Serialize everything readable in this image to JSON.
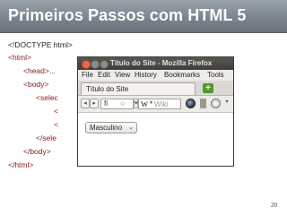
{
  "slide": {
    "title": "Primeiros Passos com HTML 5",
    "page_number": "20"
  },
  "code_lines": {
    "doctype": "<!DOCTYPE html>",
    "html_open": "<html>",
    "head": "<head>...",
    "body_open": "<body>",
    "select_open_partial": "<selec",
    "option1_partial": "<",
    "option2_partial": "<",
    "select_close_partial": "</sele",
    "body_close": "</body>",
    "html_close": "</html>"
  },
  "browser": {
    "window_title": "Título do Site - Mozilla Firefox",
    "menu": [
      "File",
      "Edit",
      "View",
      "History",
      "Bookmarks",
      "Tools"
    ],
    "tab_title": "Título do Site",
    "url_text": "fi",
    "search_engine_letter": "W",
    "search_placeholder": "Wiki",
    "select_value": "Masculino",
    "accent_colors": {
      "close_button": "#e9694b",
      "new_tab": "#4f9a2e"
    }
  }
}
